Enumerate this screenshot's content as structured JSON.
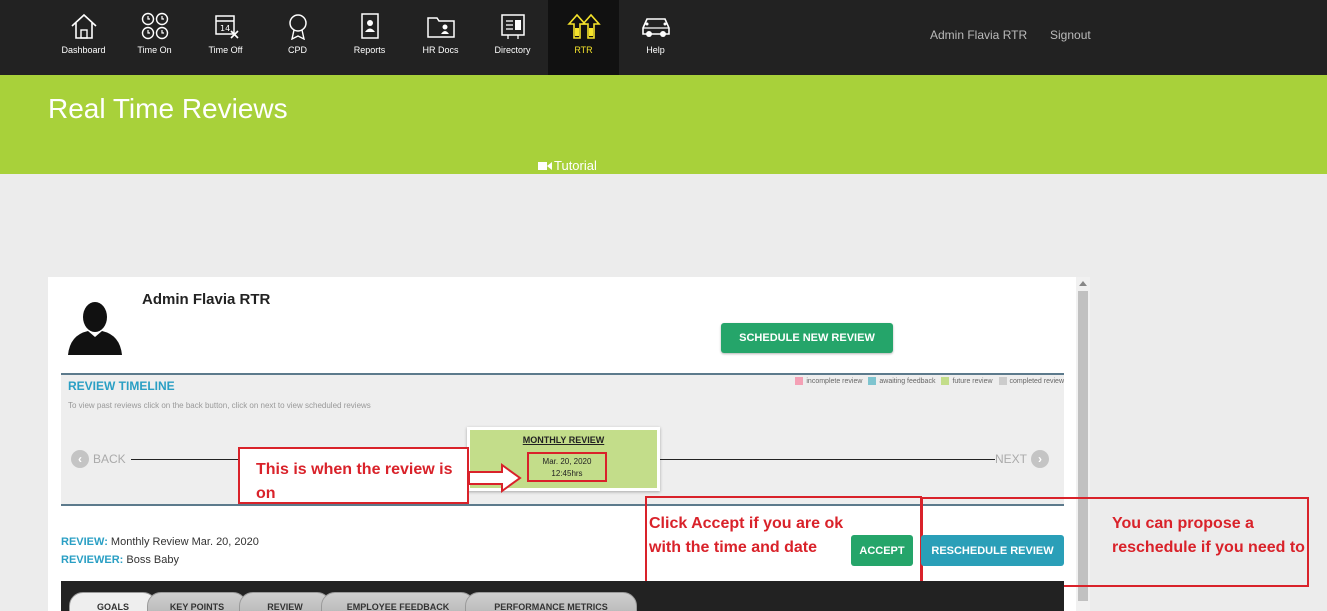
{
  "nav": {
    "items": [
      {
        "label": "Dashboard",
        "icon": "home-icon"
      },
      {
        "label": "Time On",
        "icon": "clock-icon"
      },
      {
        "label": "Time Off",
        "icon": "calendar-icon"
      },
      {
        "label": "CPD",
        "icon": "award-icon"
      },
      {
        "label": "Reports",
        "icon": "report-icon"
      },
      {
        "label": "HR Docs",
        "icon": "folder-icon"
      },
      {
        "label": "Directory",
        "icon": "directory-icon"
      },
      {
        "label": "RTR",
        "icon": "rtr-icon"
      },
      {
        "label": "Help",
        "icon": "car-icon"
      }
    ],
    "active": "RTR",
    "user": "Admin Flavia RTR",
    "signout": "Signout"
  },
  "header": {
    "title": "Real Time Reviews",
    "tutorial": "Tutorial"
  },
  "profile": {
    "name": "Admin Flavia RTR",
    "schedule_button": "SCHEDULE NEW REVIEW"
  },
  "timeline": {
    "title": "REVIEW TIMELINE",
    "subtitle": "To view past reviews click on the back button, click on next to view scheduled reviews",
    "legend": [
      {
        "label": "incomplete review",
        "color": "#f4a0b5"
      },
      {
        "label": "awaiting feedback",
        "color": "#7ec4cf"
      },
      {
        "label": "future review",
        "color": "#c3dd8a"
      },
      {
        "label": "completed review",
        "color": "#cccccc"
      }
    ],
    "back": "BACK",
    "next": "NEXT",
    "card": {
      "title": "MONTHLY REVIEW",
      "date": "Mar. 20, 2020",
      "time": "12:45hrs"
    }
  },
  "review": {
    "review_label": "REVIEW:",
    "review_value": "Monthly Review Mar. 20, 2020",
    "reviewer_label": "REVIEWER:",
    "reviewer_value": "Boss Baby",
    "accept": "ACCEPT",
    "reschedule": "RESCHEDULE REVIEW"
  },
  "annotations": {
    "when": "This is when the review is on",
    "accept": "Click Accept if you are ok with the time and date",
    "reschedule": "You can propose a reschedule if you need to"
  },
  "tabs": [
    "GOALS",
    "KEY POINTS",
    "REVIEW",
    "EMPLOYEE FEEDBACK",
    "PERFORMANCE METRICS"
  ],
  "colors": {
    "accent_green": "#a8d13a",
    "button_green": "#25a56a",
    "button_blue": "#2a9fb8",
    "annotation_red": "#d9222a"
  }
}
